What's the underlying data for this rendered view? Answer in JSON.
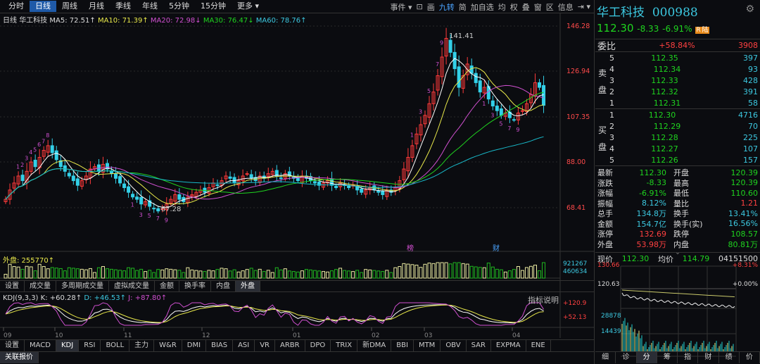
{
  "toolbar": {
    "periods": [
      "分时",
      "日线",
      "周线",
      "月线",
      "季线",
      "年线",
      "5分钟",
      "15分钟",
      "更多 ▾"
    ],
    "active": 1,
    "right": [
      "事件 ▾",
      "⊡",
      "画",
      "九转",
      "简",
      "加自选",
      "均",
      "权",
      "叠",
      "窗",
      "区",
      "信息",
      "⇥ ▾"
    ]
  },
  "ma_line": {
    "label": "日线",
    "name": "华工科技",
    "ma5": "MA5: 72.51↑",
    "ma10": "MA10: 71.39↑",
    "ma20": "MA20: 72.98↓",
    "ma30": "MA30: 76.47↓",
    "ma60": "MA60: 78.76↑"
  },
  "price_axis": [
    "146.28",
    "126.94",
    "107.35",
    "88.00",
    "68.41"
  ],
  "annotations": {
    "high": "141.41",
    "low": "67.28",
    "tag1": "榜",
    "tag2": "财"
  },
  "volume": {
    "label": "外盘: 255770↑",
    "axis": [
      "921267",
      "460634"
    ]
  },
  "volume_tabs": [
    "设置",
    "成交量",
    "多周期成交量",
    "虚拟成交量",
    "金额",
    "换手率",
    "内盘",
    "外盘"
  ],
  "kdj": {
    "label": "KDJ(9,3,3) K:",
    "k": "+60.28↑",
    "d_label": "D:",
    "d": "+46.53↑",
    "j_label": "J:",
    "j": "+87.80↑",
    "help": "指标说明",
    "axis": [
      "+120.9",
      "+52.13"
    ]
  },
  "date_axis": [
    "09",
    "10",
    "11",
    "12",
    "01",
    "02",
    "03",
    "04"
  ],
  "indicator_tabs": [
    "设置",
    "MACD",
    "KDJ",
    "RSI",
    "BOLL",
    "主力",
    "W&R",
    "DMI",
    "BIAS",
    "ASI",
    "VR",
    "ARBR",
    "DPO",
    "TRIX",
    "新DMA",
    "BBI",
    "MTM",
    "OBV",
    "SAR",
    "EXPMA",
    "ENE"
  ],
  "bottom_tab": "关联报价",
  "kline": {
    "closes": [
      72,
      76,
      79,
      82,
      80,
      84,
      88,
      86,
      90,
      93,
      95,
      92,
      89,
      86,
      84,
      82,
      80,
      78,
      80,
      82,
      85,
      86,
      84,
      87,
      85,
      83,
      81,
      79,
      77,
      75,
      73,
      72,
      70,
      71,
      69,
      68,
      67,
      68,
      70,
      72,
      74,
      72,
      71,
      73,
      74,
      75,
      76,
      75,
      77,
      79,
      78,
      80,
      82,
      81,
      79,
      80,
      82,
      83,
      81,
      80,
      82,
      81,
      83,
      84,
      82,
      81,
      83,
      82,
      81,
      80,
      82,
      81,
      80,
      79,
      78,
      79,
      80,
      78,
      77,
      79,
      78,
      77,
      78,
      76,
      75,
      76,
      77,
      76,
      75,
      74,
      76,
      75,
      77,
      80,
      85,
      90,
      95,
      100,
      104,
      108,
      113,
      118,
      125,
      133,
      141,
      135,
      128,
      120,
      125,
      130,
      126,
      122,
      118,
      120,
      115,
      112,
      110,
      108,
      109,
      107,
      106,
      109,
      110,
      113,
      117,
      122,
      120,
      112.3
    ],
    "range": [
      68.41,
      146.28
    ]
  },
  "quote": {
    "name": "华工科技",
    "code": "000988",
    "price": "112.30",
    "change": "-8.33",
    "pct": "-6.91%",
    "badge1": "R",
    "badge2": "陆",
    "weibi_label": "委比",
    "weibi": "+58.84%",
    "weicha": "3908",
    "sell_label": [
      "卖",
      "盘"
    ],
    "buy_label": [
      "买",
      "盘"
    ],
    "sells": [
      [
        "5",
        "112.35",
        "397"
      ],
      [
        "4",
        "112.34",
        "93"
      ],
      [
        "3",
        "112.33",
        "428"
      ],
      [
        "2",
        "112.32",
        "391"
      ],
      [
        "1",
        "112.31",
        "58"
      ]
    ],
    "buys": [
      [
        "1",
        "112.30",
        "4716"
      ],
      [
        "2",
        "112.29",
        "70"
      ],
      [
        "3",
        "112.28",
        "225"
      ],
      [
        "4",
        "112.27",
        "107"
      ],
      [
        "5",
        "112.26",
        "157"
      ]
    ],
    "stats": [
      [
        "最新",
        "112.30",
        "g",
        "开盘",
        "120.39",
        "g"
      ],
      [
        "涨跌",
        "-8.33",
        "g",
        "最高",
        "120.39",
        "g"
      ],
      [
        "涨幅",
        "-6.91%",
        "g",
        "最低",
        "110.60",
        "g"
      ],
      [
        "振幅",
        "8.12%",
        "c",
        "量比",
        "1.21",
        "r"
      ],
      [
        "总手",
        "134.8万",
        "c",
        "换手",
        "13.41%",
        "c"
      ],
      [
        "金额",
        "154.7亿",
        "c",
        "换手(实)",
        "16.56%",
        "c"
      ],
      [
        "涨停",
        "132.69",
        "r",
        "跌停",
        "108.57",
        "g"
      ],
      [
        "外盘",
        "53.98万",
        "r",
        "内盘",
        "80.81万",
        "g"
      ]
    ]
  },
  "intraday": {
    "now_label": "现价",
    "now": "112.30",
    "avg_label": "均价",
    "avg": "114.79",
    "time": "04151500",
    "top": "130.66",
    "top_pct": "+8.31%",
    "mid": "120.63",
    "mid_pct": "+0.00%",
    "vol1": "28878",
    "vol2": "14439"
  },
  "right_tabs": [
    "细",
    "诊",
    "分",
    "筹",
    "指",
    "财",
    "绩",
    "价"
  ]
}
